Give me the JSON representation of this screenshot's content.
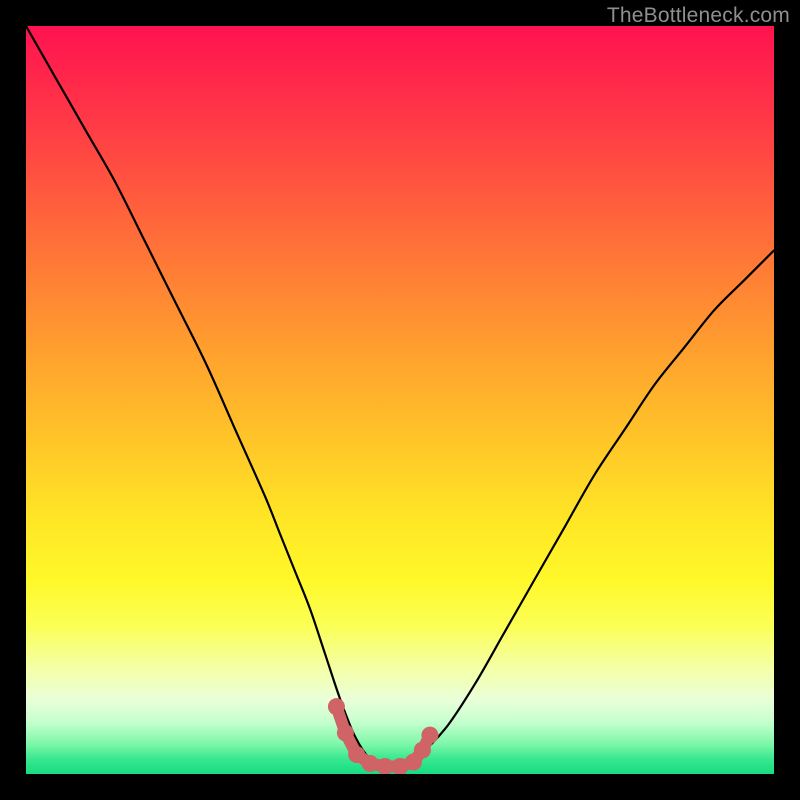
{
  "watermark": {
    "text": "TheBottleneck.com"
  },
  "colors": {
    "curve": "#000000",
    "markers": "#cf6365",
    "frame": "#000000"
  },
  "chart_data": {
    "type": "line",
    "title": "",
    "xlabel": "",
    "ylabel": "",
    "xlim": [
      0,
      100
    ],
    "ylim": [
      0,
      100
    ],
    "grid": false,
    "legend": false,
    "series": [
      {
        "name": "bottleneck-curve",
        "x": [
          0,
          4,
          8,
          12,
          16,
          20,
          24,
          28,
          32,
          34,
          36,
          38,
          40,
          42,
          44,
          46,
          48,
          50,
          52,
          56,
          60,
          64,
          68,
          72,
          76,
          80,
          84,
          88,
          92,
          96,
          100
        ],
        "y": [
          100,
          93,
          86,
          79,
          71,
          63,
          55,
          46,
          37,
          32,
          27,
          22,
          16,
          10,
          5,
          2,
          1,
          1,
          2,
          6,
          12,
          19,
          26,
          33,
          40,
          46,
          52,
          57,
          62,
          66,
          70
        ]
      }
    ],
    "markers": {
      "name": "highlight-dots",
      "x": [
        41.5,
        42.7,
        44.2,
        46.0,
        48.0,
        50.0,
        51.8,
        53.0,
        54.0
      ],
      "y": [
        9.0,
        5.5,
        2.6,
        1.4,
        1.0,
        1.0,
        1.6,
        3.2,
        5.2
      ]
    }
  }
}
